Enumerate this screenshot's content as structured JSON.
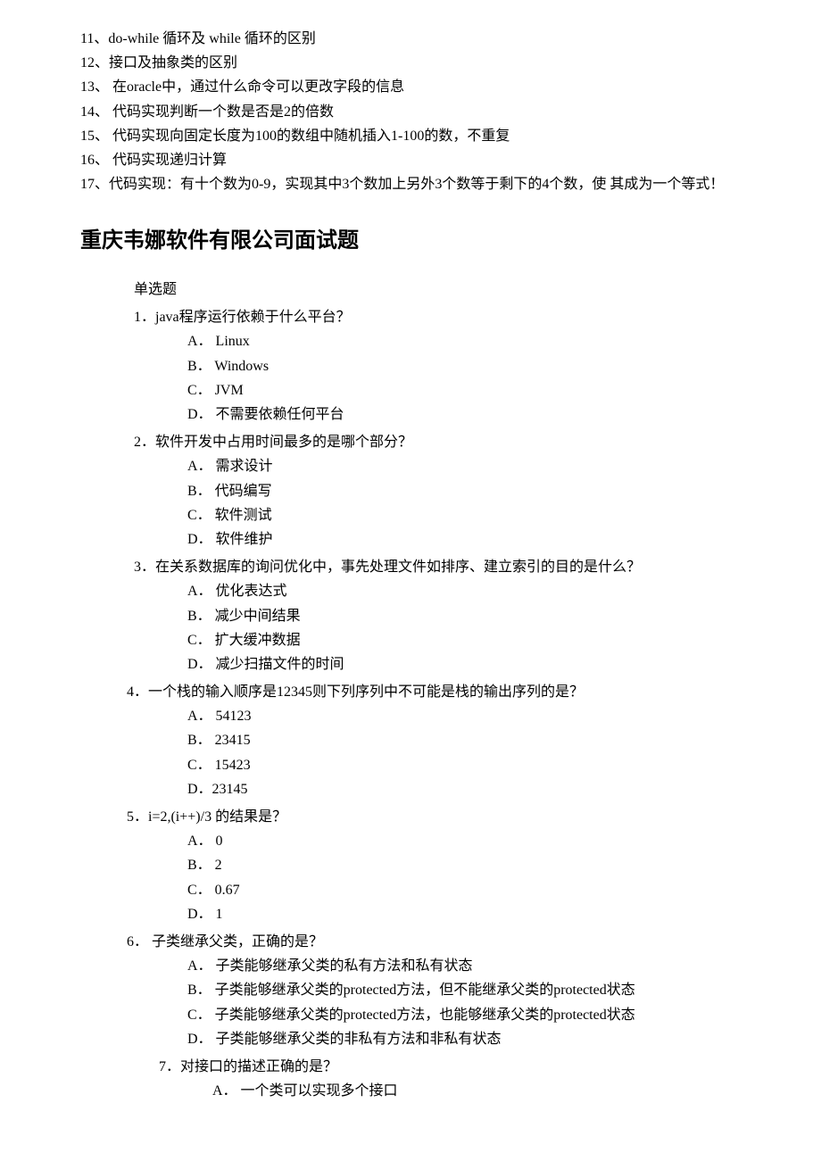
{
  "top_list": [
    "11、do-while 循环及 while 循环的区别",
    "12、接口及抽象类的区别",
    "13、 在oracle中，通过什么命令可以更改字段的信息",
    "14、 代码实现判断一个数是否是2的倍数",
    "15、 代码实现向固定长度为100的数组中随机插入1-100的数，不重复",
    "16、 代码实现递归计算",
    "17、代码实现：有十个数为0-9，实现其中3个数加上另外3个数等于剩下的4个数，使 其成为一个等式！"
  ],
  "title": "重庆韦娜软件有限公司面试题",
  "section_label": "单选题",
  "questions": [
    {
      "q": "1．java程序运行依赖于什么平台？",
      "options": [
        "A． Linux",
        "B． Windows",
        "C． JVM",
        "D． 不需要依赖任何平台"
      ]
    },
    {
      "q": "2．软件开发中占用时间最多的是哪个部分？",
      "options": [
        "A． 需求设计",
        "B． 代码编写",
        "C． 软件测试",
        "D． 软件维护"
      ]
    },
    {
      "q": "3．在关系数据库的询问优化中，事先处理文件如排序、建立索引的目的是什么？",
      "options": [
        "A． 优化表达式",
        "B． 减少中间结果",
        "C． 扩大缓冲数据",
        "D． 减少扫描文件的时间"
      ]
    },
    {
      "q": "4．一个栈的输入顺序是12345则下列序列中不可能是栈的输出序列的是？",
      "options": [
        "A． 54123",
        "B． 23415",
        "C． 15423",
        "D．23145"
      ]
    },
    {
      "q": "5．i=2,(i++)/3 的结果是？",
      "options": [
        "A． 0",
        "B． 2",
        "C． 0.67",
        "D． 1"
      ]
    },
    {
      "q": "6．   子类继承父类，正确的是？",
      "options": [
        "A． 子类能够继承父类的私有方法和私有状态",
        "B． 子类能够继承父类的protected方法，但不能继承父类的protected状态",
        "C． 子类能够继承父类的protected方法，也能够继承父类的protected状态",
        "D． 子类能够继承父类的非私有方法和非私有状态"
      ]
    }
  ],
  "q7": {
    "q": "7．对接口的描述正确的是？",
    "option_a": "A． 一个类可以实现多个接口"
  }
}
